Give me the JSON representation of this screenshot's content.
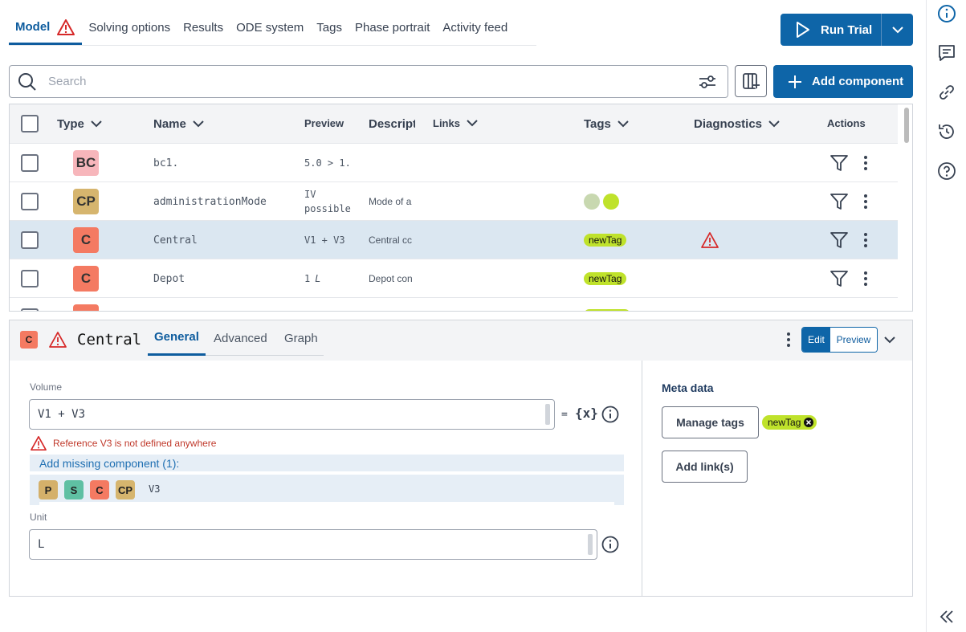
{
  "tabs": [
    {
      "label": "Model"
    },
    {
      "label": "Solving options"
    },
    {
      "label": "Results"
    },
    {
      "label": "ODE system"
    },
    {
      "label": "Tags"
    },
    {
      "label": "Phase portrait"
    },
    {
      "label": "Activity feed"
    }
  ],
  "run_trial": {
    "label": "Run Trial"
  },
  "search": {
    "placeholder": "Search",
    "value": ""
  },
  "add_component": {
    "label": "Add component"
  },
  "table": {
    "headers": {
      "type": "Type",
      "name": "Name",
      "preview": "Preview",
      "description": "Descript",
      "links": "Links",
      "tags": "Tags",
      "diagnostics": "Diagnostics",
      "actions": "Actions"
    },
    "rows": [
      {
        "type": "BC",
        "name": "bc1.",
        "preview": "5.0 > 1.",
        "description": "",
        "tag": ""
      },
      {
        "type": "CP",
        "name": "administrationMode",
        "preview_line1": "IV",
        "preview_line2": "possible",
        "description": "Mode of a",
        "tag": ""
      },
      {
        "type": "C",
        "name": "Central",
        "preview": "V1 + V3",
        "description": "Central cc",
        "tag": "newTag"
      },
      {
        "type": "C",
        "name": "Depot",
        "preview": "1",
        "preview_unit": "L",
        "description": "Depot con",
        "tag": "newTag"
      }
    ]
  },
  "detail": {
    "type": "C",
    "title": "Central",
    "tabs": [
      {
        "label": "General"
      },
      {
        "label": "Advanced"
      },
      {
        "label": "Graph"
      }
    ],
    "edit_label": "Edit",
    "preview_label": "Preview",
    "volume_label": "Volume",
    "volume_value": "V1 + V3",
    "equals": "=",
    "var_icon": "{x}",
    "error_text": "Reference V3 is not defined anywhere",
    "missing_title": "Add missing component (1):",
    "missing_badges": [
      "P",
      "S",
      "C",
      "CP"
    ],
    "missing_name": "V3",
    "unit_label": "Unit",
    "unit_value": "L",
    "meta_title": "Meta data",
    "manage_tags": "Manage tags",
    "tag": "newTag",
    "add_links": "Add link(s)"
  },
  "colors": {
    "primary": "#0e65a8",
    "bc_badge": "#f7b6bb",
    "cp_badge": "#d6b56e",
    "c_badge": "#f47a62",
    "p_badge": "#d4b06a",
    "s_badge": "#5fc0a3",
    "tag_green": "#bfe22b",
    "error": "#c0392b",
    "selected_row": "#dbe7f1"
  }
}
